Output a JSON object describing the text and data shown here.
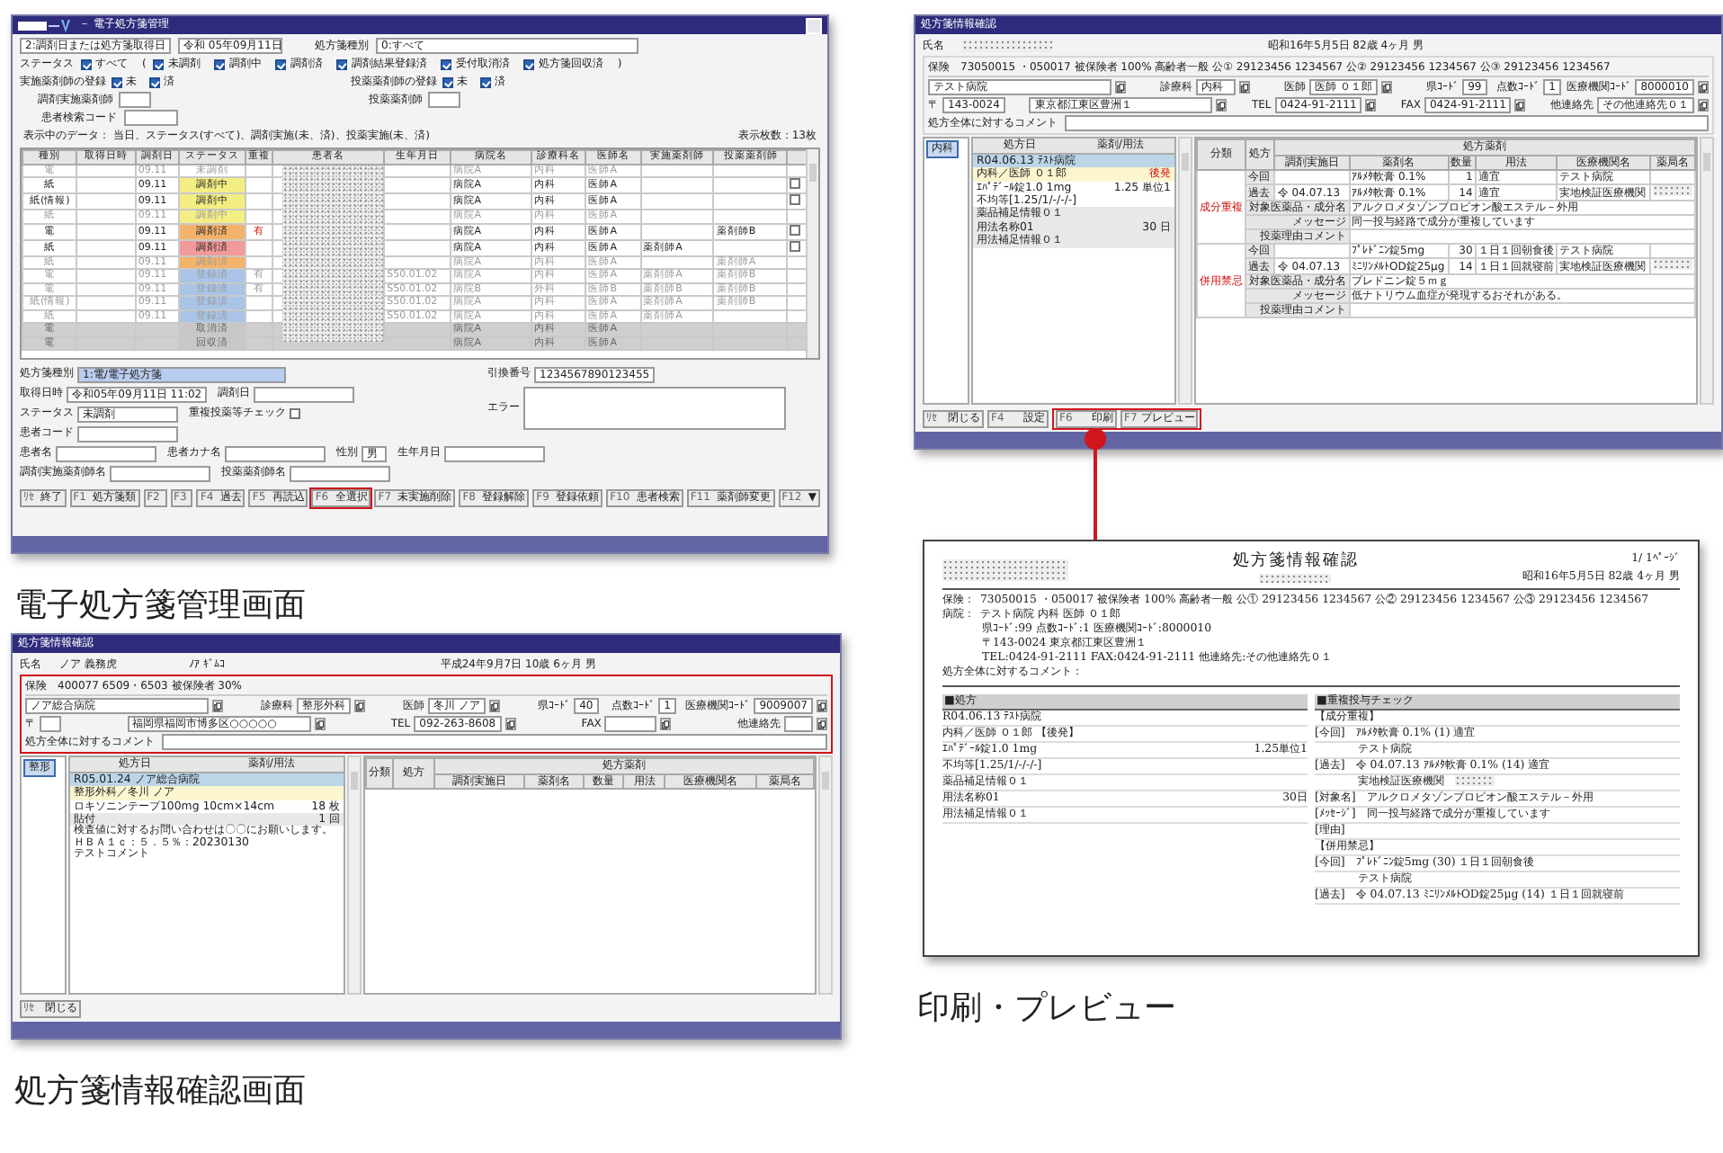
{
  "management_window": {
    "title": "－ 電子処方箋管理",
    "filter": {
      "date_type": "2:調剤日または処方箋取得日",
      "date": "令和 05年09月11日",
      "kind_label": "処方箋種別",
      "kind_value": "0:すべて",
      "status_label": "ステータス",
      "status_all": {
        "label": "すべて",
        "checked": true
      },
      "open_paren": "(",
      "close_paren": ")",
      "statuses": [
        {
          "label": "未調剤",
          "checked": true
        },
        {
          "label": "調剤中",
          "checked": true
        },
        {
          "label": "調剤済",
          "checked": true
        },
        {
          "label": "調剤結果登録済",
          "checked": true
        },
        {
          "label": "受付取消済",
          "checked": true
        },
        {
          "label": "処方箋回収済",
          "checked": true
        }
      ],
      "registrations": [
        {
          "label": "実施薬剤師の登録",
          "options": [
            {
              "label": "未",
              "checked": true
            },
            {
              "label": "済",
              "checked": true
            }
          ]
        },
        {
          "label": "投薬薬剤師の登録",
          "options": [
            {
              "label": "未",
              "checked": true
            },
            {
              "label": "済",
              "checked": true
            }
          ]
        }
      ],
      "pharmacist_fields": [
        {
          "label": "調剤実施薬剤師"
        },
        {
          "label": "投薬薬剤師"
        }
      ],
      "patient_code": {
        "label": "患者検索コード"
      }
    },
    "summary": "表示中のデータ： 当日、ステータス(すべて)、調剤実施(未、済)、投薬実施(未、済)",
    "count": "表示枚数：13枚",
    "table": {
      "columns": [
        "種別",
        "取得日時",
        "調剤日",
        "ステータス",
        "重複",
        "患者名",
        "生年月日",
        "病院名",
        "診療科名",
        "医師名",
        "実施薬剤師",
        "投薬薬剤師"
      ],
      "rows": [
        {
          "kind": "greyed",
          "type": "電",
          "date": "09.11",
          "status": "未調剤",
          "color": "#ffffff",
          "hospital": "病院A",
          "dept": "内科",
          "doctor": "医師A"
        },
        {
          "kind": "normal",
          "type": "紙",
          "date": "09.11",
          "status": "調剤中",
          "color": "#f3ee84",
          "hospital": "病院A",
          "dept": "内科",
          "doctor": "医師A",
          "checkbox": {
            "checked": false
          }
        },
        {
          "kind": "normal",
          "type": "紙(情報)",
          "date": "09.11",
          "status": "調剤中",
          "color": "#f3ee84",
          "hospital": "病院A",
          "dept": "内科",
          "doctor": "医師A",
          "checkbox": {
            "checked": false
          }
        },
        {
          "kind": "greyed",
          "type": "紙",
          "date": "09.11",
          "status": "調剤中",
          "color": "#f3ee84",
          "hospital": "病院A",
          "dept": "内科",
          "doctor": "医師A"
        },
        {
          "kind": "normal",
          "type": "電",
          "date": "09.11",
          "status": "調剤済",
          "color": "#f4b36a",
          "dup": "有",
          "hospital": "病院A",
          "dept": "内科",
          "doctor": "医師A",
          "admin": "薬剤師B",
          "checkbox": {
            "checked": false
          }
        },
        {
          "kind": "normal",
          "type": "紙",
          "date": "09.11",
          "status": "調剤済",
          "color": "#f19a9a",
          "hospital": "病院A",
          "dept": "内科",
          "doctor": "医師A",
          "disp": "薬剤師A",
          "checkbox": {
            "checked": false
          }
        },
        {
          "kind": "greyed",
          "type": "紙",
          "date": "09.11",
          "status": "調剤済",
          "color": "#f4b36a",
          "hospital": "病院A",
          "dept": "内科",
          "doctor": "医師A",
          "admin": "薬剤師A"
        },
        {
          "kind": "greyed",
          "type": "電",
          "date": "09.11",
          "status": "登録済",
          "color": "#a9c4e6",
          "dup": "有",
          "birth": "S50.01.02",
          "hospital": "病院A",
          "dept": "内科",
          "doctor": "医師A",
          "disp": "薬剤師A",
          "admin": "薬剤師B"
        },
        {
          "kind": "greyed",
          "type": "電",
          "date": "09.11",
          "status": "登録済",
          "color": "#a9c4e6",
          "dup": "有",
          "birth": "S50.01.02",
          "hospital": "病院B",
          "dept": "外科",
          "doctor": "医師B",
          "disp": "薬剤師B",
          "admin": "薬剤師B"
        },
        {
          "kind": "greyed",
          "type": "紙(情報)",
          "date": "09.11",
          "status": "登録済",
          "color": "#a9c4e6",
          "birth": "S50.01.02",
          "hospital": "病院A",
          "dept": "内科",
          "doctor": "医師A",
          "disp": "薬剤師A",
          "admin": "薬剤師B"
        },
        {
          "kind": "greyed",
          "type": "紙",
          "date": "09.11",
          "status": "登録済",
          "color": "#a9c4e6",
          "birth": "S50.01.02",
          "hospital": "病院A",
          "dept": "内科",
          "doctor": "医師A",
          "disp": "薬剤師A"
        },
        {
          "kind": "cancelled",
          "type": "電",
          "status": "取消済",
          "color": "#c8c8c8",
          "hospital": "病院A",
          "dept": "内科",
          "doctor": "医師A"
        },
        {
          "kind": "cancelled",
          "type": "電",
          "status": "回収済",
          "color": "#c8c8c8",
          "hospital": "病院A",
          "dept": "内科",
          "doctor": "医師A"
        }
      ]
    },
    "detail": {
      "left": [
        [
          {
            "label": "処方箋種別",
            "value": "1:電/電子処方箋",
            "kind": "emphasis"
          }
        ],
        [
          {
            "label": "取得日時",
            "value": "令和05年09月11日 11:02",
            "kind": "text"
          },
          {
            "label": "調剤日",
            "kind": "text"
          }
        ],
        [
          {
            "label": "ステータス",
            "value": "未調剤",
            "kind": "text"
          },
          {
            "label": "重複投薬等チェック",
            "kind": "checkbox",
            "checked": false
          }
        ],
        [
          {
            "label": "患者コード",
            "kind": "text"
          }
        ],
        [
          {
            "label": "患者名",
            "kind": "text"
          },
          {
            "label": "患者カナ名",
            "kind": "text"
          },
          {
            "label": "性別",
            "value": "男",
            "kind": "short"
          },
          {
            "label": "生年月日",
            "kind": "text"
          }
        ],
        [
          {
            "label": "調剤実施薬剤師名",
            "kind": "text"
          },
          {
            "label": "投薬薬剤師名",
            "kind": "text"
          }
        ]
      ],
      "right": [
        [
          {
            "label": "引換番号",
            "value": "1234567890123455",
            "kind": "code"
          }
        ],
        [
          {
            "label": "エラー",
            "kind": "textarea"
          }
        ]
      ]
    },
    "function_keys": [
      {
        "key": "ﾘｾ",
        "label": "終了",
        "highlighted": false
      },
      {
        "key": "F1",
        "label": "処方箋類",
        "highlighted": false
      },
      {
        "key": "F2",
        "highlighted": false
      },
      {
        "key": "F3",
        "highlighted": false
      },
      {
        "key": "F4",
        "label": "過去",
        "highlighted": false
      },
      {
        "key": "F5",
        "label": "再読込",
        "highlighted": false
      },
      {
        "key": "F6",
        "label": "全選択",
        "highlighted": true
      },
      {
        "key": "F7",
        "label": "未実施削除",
        "highlighted": false
      },
      {
        "key": "F8",
        "label": "登録解除",
        "highlighted": false
      },
      {
        "key": "F9",
        "label": "登録依頼",
        "highlighted": false
      },
      {
        "key": "F10",
        "label": "患者検索",
        "highlighted": false
      },
      {
        "key": "F11",
        "label": "薬剤師変更",
        "highlighted": false
      },
      {
        "key": "F12",
        "label": "▼",
        "highlighted": false
      }
    ]
  },
  "management_caption": "電子処方箋管理画面",
  "info_window": {
    "title": "処方箋情報確認",
    "highlighted": true,
    "patient": {
      "label": "氏名",
      "name": "ノア 義務虎",
      "kana": "ﾉｱ ｷﾞﾑｺ",
      "birth": "平成24年9月7日 10歳 6ヶ月 男"
    },
    "insurance": {
      "label": "保険",
      "text": "400077 6509・6503 被保険者 30%"
    },
    "institution": [
      [
        {
          "value": "ノア総合病院",
          "copy": true
        },
        {
          "label": "診療科",
          "value": "整形外科",
          "copy": true
        },
        {
          "label": "医師",
          "value": "冬川 ノア",
          "copy": true
        },
        {
          "label": "県ｺｰﾄﾞ",
          "value": "40",
          "copy": false
        },
        {
          "label": "点数ｺｰﾄﾞ",
          "value": "1",
          "copy": false
        },
        {
          "label": "医療機関ｺｰﾄﾞ",
          "value": "9009007",
          "copy": true
        }
      ],
      [
        {
          "label": "〒",
          "copy": false
        },
        {
          "value": "福岡県福岡市博多区○○○○○",
          "copy": true
        },
        {
          "label": "TEL",
          "value": "092-263-8608",
          "copy": true
        },
        {
          "label": "FAX",
          "copy": true
        },
        {
          "label": "他連絡先",
          "copy": true
        }
      ]
    ],
    "comment": {
      "label": "処方全体に対するコメント"
    },
    "tab": {
      "label": "整形",
      "selected": true
    },
    "left_columns": [
      "処方日",
      "薬剤/用法"
    ],
    "entries": [
      {
        "kind": "visit",
        "text": "R05.01.24 ノア総合病院"
      },
      {
        "kind": "doctor",
        "text": "整形外科／冬川 ノア"
      },
      {
        "kind": "drug",
        "text": "ロキソニンテープ100mg 10cm×14cm",
        "amount": "18 枚"
      },
      {
        "kind": "usage",
        "text": "貼付",
        "amount": "1 回"
      },
      {
        "kind": "comment",
        "text": "検査値に対するお問い合わせは〇〇にお願いします。"
      },
      {
        "kind": "comment",
        "text": "ＨＢＡ１ｃ：５．５％：20230130"
      },
      {
        "kind": "comment",
        "text": "テストコメント"
      }
    ],
    "right_header": {
      "category": "分類",
      "prescription": "処方",
      "drugs": "処方薬剤",
      "columns": [
        "調剤実施日",
        "薬剤名",
        "数量",
        "用法",
        "医療機関名",
        "薬局名"
      ]
    },
    "buttons": [
      {
        "key": "ﾘｾ",
        "label": "閉じる",
        "highlighted": false
      }
    ]
  },
  "info_caption": "処方箋情報確認画面",
  "check_window": {
    "title": "処方箋情報確認",
    "highlighted": false,
    "patient": {
      "label": "氏名",
      "name_hidden": true,
      "birth": "昭和16年5月5日 82歳 4ヶ月 男"
    },
    "insurance": {
      "label": "保険",
      "text": "73050015 ・050017 被保険者 100% 高齢者一般 公① 29123456 1234567 公② 29123456 1234567 公③ 29123456 1234567"
    },
    "institution": [
      [
        {
          "value": "テスト病院",
          "copy": true
        },
        {
          "label": "診療科",
          "value": "内科",
          "copy": true
        },
        {
          "label": "医師",
          "value": "医師 ０１郎",
          "copy": true
        },
        {
          "label": "県ｺｰﾄﾞ",
          "value": "99",
          "copy": false
        },
        {
          "label": "点数ｺｰﾄﾞ",
          "value": "1",
          "copy": false
        },
        {
          "label": "医療機関ｺｰﾄﾞ",
          "value": "8000010",
          "copy": true
        }
      ],
      [
        {
          "label": "〒",
          "value": "143-0024",
          "copy": false
        },
        {
          "value": "東京都江東区豊洲１",
          "copy": true
        },
        {
          "label": "TEL",
          "value": "0424-91-2111",
          "copy": true
        },
        {
          "label": "FAX",
          "value": "0424-91-2111",
          "copy": true
        },
        {
          "label": "他連絡先",
          "value": "その他連絡先０１",
          "copy": true
        }
      ]
    ],
    "comment": {
      "label": "処方全体に対するコメント"
    },
    "tab": {
      "label": "内科",
      "selected": true
    },
    "left_columns": [
      "処方日",
      "薬剤/用法"
    ],
    "entries": [
      {
        "kind": "visit",
        "text": "R04.06.13 ﾃｽﾄ病院"
      },
      {
        "kind": "doctor",
        "text": "内科／医師 ０１郎",
        "badge": "後発"
      },
      {
        "kind": "drug",
        "text": "ｴﾊﾟﾃﾞｰﾙ錠1.0 1mg",
        "amount": "1.25 単位1"
      },
      {
        "kind": "drug",
        "text": "不均等[1.25/1/-/-/-]"
      },
      {
        "kind": "usage",
        "text": "薬品補足情報０１"
      },
      {
        "kind": "usage",
        "text": "用法名称01",
        "amount": "30 日"
      },
      {
        "kind": "usage",
        "text": "用法補足情報０１"
      }
    ],
    "right_header": {
      "category": "分類",
      "prescription": "処方",
      "drugs": "処方薬剤",
      "columns": [
        "調剤実施日",
        "薬剤名",
        "数量",
        "用法",
        "医療機関名",
        "薬局名"
      ]
    },
    "groups": [
      {
        "label": "成分重複",
        "rows": [
          {
            "label": "今回",
            "drug": "ｱﾙﾒﾀ軟膏 0.1%",
            "qty": "1",
            "usage": "適宜",
            "facility": "テスト病院",
            "pharmacy_hidden": false
          },
          {
            "label": "過去",
            "date": "令 04.07.13",
            "drug": "ｱﾙﾒﾀ軟膏 0.1%",
            "qty": "14",
            "usage": "適宜",
            "facility": "実地検証医療機関",
            "pharmacy_hidden": true
          }
        ],
        "notes": [
          {
            "label": "対象医薬品・成分名",
            "value": "アルクロメタゾンプロピオン酸エステル－外用"
          },
          {
            "label": "メッセージ",
            "value": "同一投与経路で成分が重複しています"
          },
          {
            "label": "投薬理由コメント"
          }
        ]
      },
      {
        "label": "併用禁忌",
        "rows": [
          {
            "label": "今回",
            "drug": "ﾌﾟﾚﾄﾞﾆﾝ錠5mg",
            "qty": "30",
            "usage": "１日１回朝食後",
            "facility": "テスト病院",
            "pharmacy_hidden": false
          },
          {
            "label": "過去",
            "date": "令 04.07.13",
            "drug": "ﾐﾆﾘﾝﾒﾙﾄOD錠25μg",
            "qty": "14",
            "usage": "１日１回就寝前",
            "facility": "実地検証医療機関",
            "pharmacy_hidden": true
          }
        ],
        "notes": [
          {
            "label": "対象医薬品・成分名",
            "value": "プレドニン錠５ｍｇ"
          },
          {
            "label": "メッセージ",
            "value": "低ナトリウム血症が発現するおそれがある。"
          },
          {
            "label": "投薬理由コメント"
          }
        ]
      }
    ],
    "buttons": [
      {
        "key": "ﾘｾ",
        "label": "閉じる",
        "highlighted": false
      },
      {
        "key": "F4",
        "label": "設定",
        "highlighted": false
      },
      {
        "key": "F6",
        "label": "印刷",
        "highlighted": true
      },
      {
        "key": "F7",
        "label": "プレビュー",
        "highlighted": true
      }
    ]
  },
  "preview": {
    "title": "処方箋情報確認",
    "page": "1/ 1ﾍﾟｰｼﾞ",
    "patient": "昭和16年5月5日 82歳 4ヶ月 男",
    "lines": [
      {
        "kind": "labeled",
        "label": "保険：",
        "text": "73050015 ・050017 被保険者 100% 高齢者一般 公① 29123456 1234567 公② 29123456 1234567 公③ 29123456 1234567"
      },
      {
        "kind": "labeled",
        "label": "病院：",
        "text": "テスト病院 内科 医師 ０１郎"
      },
      {
        "kind": "continued",
        "text": "県ｺｰﾄﾞ:99 点数ｺｰﾄﾞ:1 医療機関ｺｰﾄﾞ:8000010"
      },
      {
        "kind": "continued",
        "text": "〒143-0024 東京都江東区豊洲１"
      },
      {
        "kind": "continued",
        "text": "TEL:0424-91-2111 FAX:0424-91-2111 他連絡先:その他連絡先０１"
      },
      {
        "kind": "plain",
        "text": "処方全体に対するコメント："
      }
    ],
    "left": {
      "heading": "■処方",
      "lines": [
        {
          "text": "R04.06.13 ﾃｽﾄ病院"
        },
        {
          "text": "内科／医師 ０１郎 【後発】"
        },
        {
          "text": "ｴﾊﾟﾃﾞｰﾙ錠1.0 1mg",
          "amount": "1.25単位1"
        },
        {
          "text": "不均等[1.25/1/-/-/-]"
        },
        {
          "text": "薬品補足情報０１"
        },
        {
          "text": "用法名称01",
          "amount": "30日"
        },
        {
          "text": "用法補足情報０１"
        }
      ]
    },
    "right": {
      "heading": "■重複投与チェック",
      "lines": [
        {
          "kind": "section",
          "text": "【成分重複】"
        },
        {
          "kind": "entry",
          "tag": "[今回]",
          "text": "ｱﾙﾒﾀ軟膏 0.1% (1) 適宜"
        },
        {
          "kind": "indent",
          "text": "テスト病院"
        },
        {
          "kind": "entry",
          "tag": "[過去]",
          "text": "令 04.07.13 ｱﾙﾒﾀ軟膏 0.1% (14) 適宜"
        },
        {
          "kind": "indent",
          "text": "実地検証医療機関",
          "hidden_tail": true
        },
        {
          "kind": "entry",
          "tag": "[対象名]",
          "text": "アルクロメタゾンプロピオン酸エステル－外用"
        },
        {
          "kind": "entry",
          "tag": "[ﾒｯｾｰｼﾞ]",
          "text": "同一投与経路で成分が重複しています"
        },
        {
          "kind": "entry",
          "tag": "[理由]"
        },
        {
          "kind": "section",
          "text": "【併用禁忌】"
        },
        {
          "kind": "entry",
          "tag": "[今回]",
          "text": "ﾌﾟﾚﾄﾞﾆﾝ錠5mg (30) １日１回朝食後"
        },
        {
          "kind": "indent",
          "text": "テスト病院"
        },
        {
          "kind": "entry",
          "tag": "[過去]",
          "text": "令 04.07.13 ﾐﾆﾘﾝﾒﾙﾄOD錠25μg (14) １日１回就寝前"
        }
      ]
    }
  },
  "preview_caption": "印刷・プレビュー"
}
